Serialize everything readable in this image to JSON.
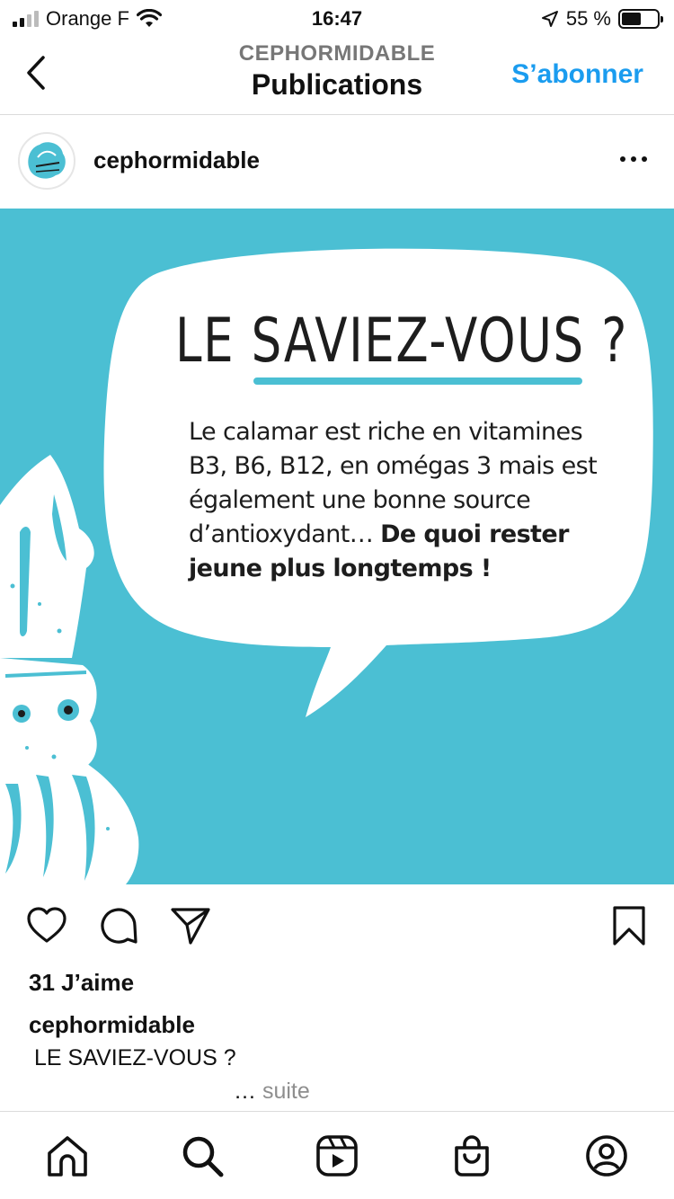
{
  "status_bar": {
    "carrier": "Orange F",
    "time": "16:47",
    "battery": "55 %",
    "battery_level": 0.55
  },
  "nav": {
    "subtitle": "CEPHORMIDABLE",
    "title": "Publications",
    "follow_label": "S’abonner"
  },
  "post": {
    "username": "cephormidable",
    "image": {
      "headline": "LE SAVIEZ-VOUS ?",
      "body_regular": "Le calamar est riche en vitamines B3, B6, B12, en omégas 3 mais est également une bonne source d’antioxydant… ",
      "body_bold": "De quoi rester jeune plus longtemps !"
    },
    "likes": "31 J’aime",
    "caption_user": "cephormidable",
    "caption_text": "LE SAVIEZ-VOUS ?",
    "more_dots": "…",
    "more_label": "suite"
  },
  "colors": {
    "post_background": "#4bbfd3",
    "link_blue": "#1a9cef",
    "muted_grey": "#8e8e8e"
  },
  "icons": [
    "back-chevron-icon",
    "more-dots-icon",
    "heart-icon",
    "comment-icon",
    "share-icon",
    "bookmark-icon",
    "home-icon",
    "search-icon",
    "reels-icon",
    "shop-icon",
    "profile-icon"
  ]
}
